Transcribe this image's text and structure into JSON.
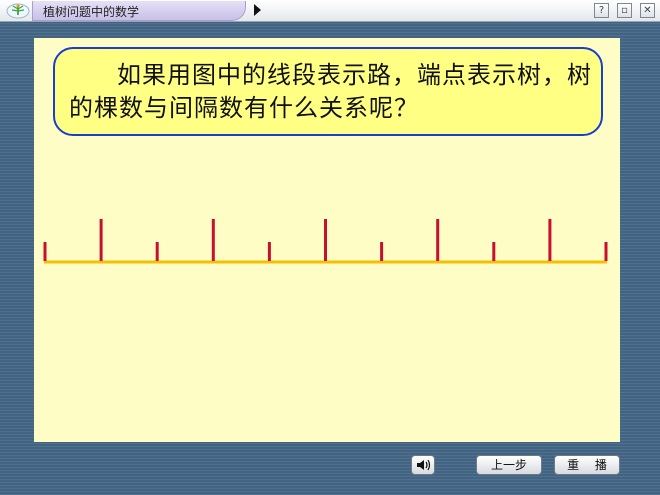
{
  "titlebar": {
    "title": "植树问题中的数学",
    "help_glyph": "?",
    "restore_glyph": "▫",
    "close_glyph": "✕"
  },
  "main": {
    "question": "如果用图中的线段表示路，端点表示树，树的棵数与间隔数有什么关系呢？"
  },
  "diagram": {
    "line_color": "#f4bf00",
    "tick_color": "#c8102e",
    "tick_count": 11,
    "tall_tick_positions": [
      1,
      3,
      5,
      7,
      9
    ]
  },
  "controls": {
    "speaker_icon": "speaker-icon",
    "prev_label": "上一步",
    "replay_label": "重 播"
  }
}
